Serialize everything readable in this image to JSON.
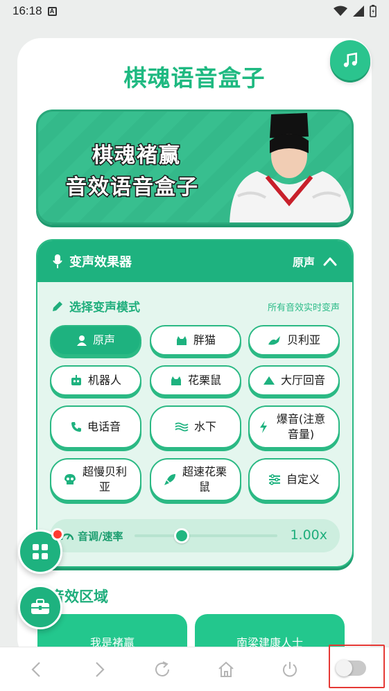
{
  "status_bar": {
    "time": "16:18",
    "notification_badge": "A"
  },
  "app": {
    "title": "棋魂语音盒子"
  },
  "banner": {
    "line1": "棋魂褚赢",
    "line2": "音效语音盒子"
  },
  "voice_changer": {
    "title": "变声效果器",
    "current_effect": "原声",
    "mode_label": "选择变声模式",
    "mode_hint": "所有音效实时变声",
    "modes": [
      {
        "label": "原声",
        "icon": "person-icon",
        "active": true
      },
      {
        "label": "胖猫",
        "icon": "cat-icon",
        "active": false
      },
      {
        "label": "贝利亚",
        "icon": "dragon-icon",
        "active": false
      },
      {
        "label": "机器人",
        "icon": "robot-icon",
        "active": false
      },
      {
        "label": "花栗鼠",
        "icon": "cat-icon",
        "active": false
      },
      {
        "label": "大厅回音",
        "icon": "mountain-icon",
        "active": false
      },
      {
        "label": "电话音",
        "icon": "phone-icon",
        "active": false
      },
      {
        "label": "水下",
        "icon": "water-icon",
        "active": false
      },
      {
        "label": "爆音(注意音量)",
        "icon": "bolt-icon",
        "active": false
      },
      {
        "label": "超慢贝利亚",
        "icon": "skull-icon",
        "active": false
      },
      {
        "label": "超速花栗鼠",
        "icon": "rocket-icon",
        "active": false
      },
      {
        "label": "自定义",
        "icon": "sliders-icon",
        "active": false
      }
    ],
    "pitch": {
      "label": "音调/速率",
      "value": "1.00x",
      "slider_fraction": 0.33
    }
  },
  "sound_effects": {
    "title": "音效区域",
    "items": [
      {
        "label": "我是褚赢"
      },
      {
        "label": "南梁建康人士"
      }
    ]
  },
  "colors": {
    "accent": "#1eb27f",
    "accent_light": "#e4f6ee",
    "title_green": "#1fb981"
  }
}
